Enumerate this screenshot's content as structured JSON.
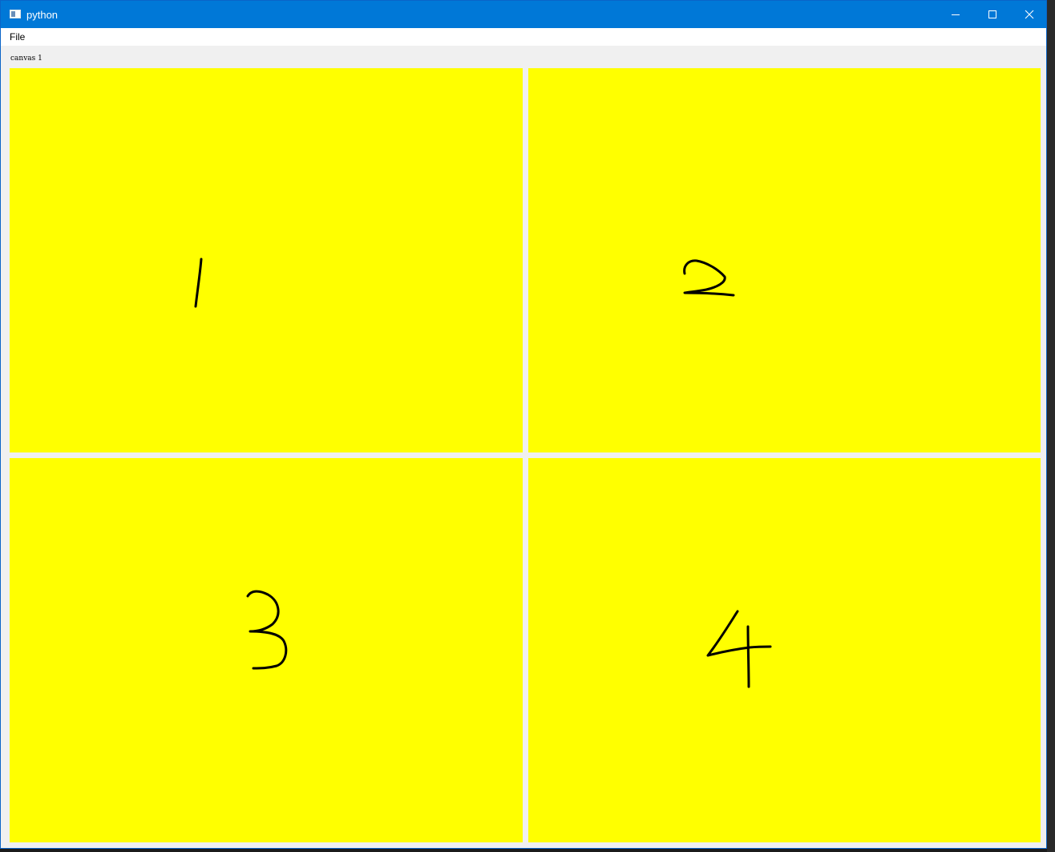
{
  "window": {
    "title": "python"
  },
  "menubar": {
    "items": [
      "File"
    ]
  },
  "canvas": {
    "label": "canvas 1",
    "panel_color": "#ffff00",
    "panels": [
      {
        "glyph": "digit-one"
      },
      {
        "glyph": "digit-two"
      },
      {
        "glyph": "digit-three"
      },
      {
        "glyph": "digit-four"
      }
    ]
  },
  "colors": {
    "titlebar": "#0078d7",
    "panel": "#ffff00",
    "stroke": "#000000"
  },
  "icons": {
    "app": "window-app-icon",
    "minimize": "minimize-icon",
    "maximize": "maximize-icon",
    "close": "close-icon"
  }
}
